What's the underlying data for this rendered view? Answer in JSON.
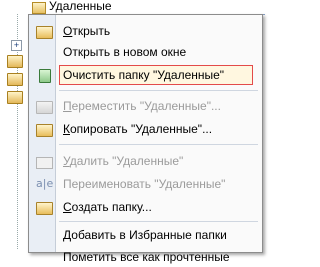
{
  "background": {
    "top_folder_label": "Удаленные"
  },
  "menu": {
    "items": [
      {
        "label": "Открыть",
        "ul": "О",
        "rest": "ткрыть",
        "icon": "folder-open-icon",
        "disabled": false
      },
      {
        "label": "Открыть в новом окне",
        "ul": "",
        "rest": "Открыть в новом окне",
        "icon": "",
        "disabled": false
      },
      {
        "label": "Очистить папку \"Удаленные\"",
        "ul": "",
        "rest": "Очистить папку \"Удаленные\"",
        "icon": "recycle-bin-icon",
        "disabled": false,
        "highlighted": true
      },
      {
        "label": "Переместить \"Удаленные\"...",
        "ul": "П",
        "rest": "ереместить \"Удаленные\"...",
        "icon": "move-folder-icon",
        "disabled": true
      },
      {
        "label": "Копировать \"Удаленные\"...",
        "ul": "К",
        "rest": "опировать \"Удаленные\"...",
        "icon": "copy-folder-icon",
        "disabled": false
      },
      {
        "label": "Удалить \"Удаленные\"",
        "ul": "У",
        "rest": "далить \"Удаленные\"",
        "icon": "delete-icon",
        "disabled": true
      },
      {
        "label": "Переименовать \"Удаленные\"",
        "ul": "",
        "rest": "Переименовать \"Удаленные\"",
        "icon": "rename-icon",
        "disabled": true
      },
      {
        "label": "Создать папку...",
        "ul": "С",
        "rest": "оздать папку...",
        "icon": "new-folder-icon",
        "disabled": false
      },
      {
        "label": "Добавить в Избранные папки",
        "ul": "Д",
        "rest": "обавить в Избранные папки",
        "icon": "",
        "disabled": false
      },
      {
        "label": "Пометить все как прочтенные",
        "ul": "",
        "rest": "Пометить все как прочтенные",
        "icon": "",
        "disabled": false
      }
    ]
  }
}
